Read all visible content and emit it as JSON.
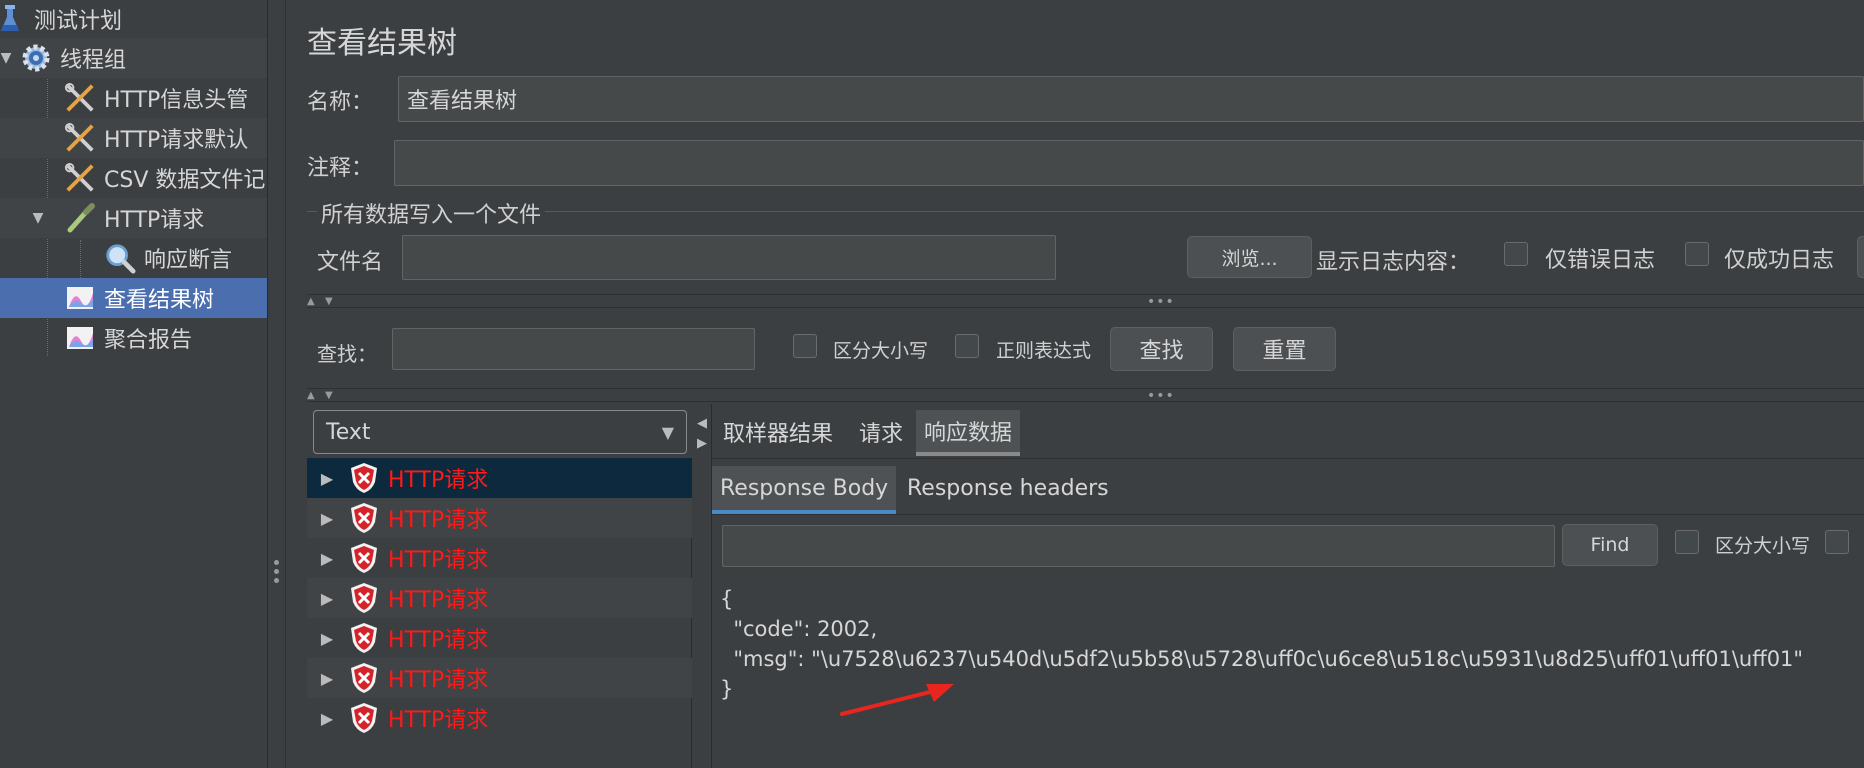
{
  "tree": {
    "items": [
      {
        "label": "测试计划",
        "icon": "flask-icon"
      },
      {
        "label": "线程组",
        "icon": "gear-icon"
      },
      {
        "label": "HTTP信息头管",
        "icon": "wrench-scissors-icon"
      },
      {
        "label": "HTTP请求默认",
        "icon": "wrench-scissors-icon"
      },
      {
        "label": "CSV 数据文件记",
        "icon": "wrench-scissors-icon"
      },
      {
        "label": "HTTP请求",
        "icon": "pipette-icon"
      },
      {
        "label": "响应断言",
        "icon": "magnifier-icon"
      },
      {
        "label": "查看结果树",
        "icon": "graph-icon"
      },
      {
        "label": "聚合报告",
        "icon": "graph-icon"
      }
    ]
  },
  "panel": {
    "title": "查看结果树",
    "name_label": "名称：",
    "name_value": "查看结果树",
    "comment_label": "注释：",
    "comment_value": "",
    "file_section_title": "所有数据写入一个文件",
    "filename_label": "文件名",
    "filename_value": "",
    "browse_button": "浏览...",
    "log_display_label": "显示日志内容：",
    "errors_only_label": "仅错误日志",
    "success_only_label": "仅成功日志"
  },
  "search": {
    "label": "查找：",
    "value": "",
    "case_sensitive_label": "区分大小写",
    "regex_label": "正则表达式",
    "find_button": "查找",
    "reset_button": "重置"
  },
  "renderer": {
    "selected": "Text"
  },
  "results": [
    {
      "label": "HTTP请求",
      "status": "error"
    },
    {
      "label": "HTTP请求",
      "status": "error"
    },
    {
      "label": "HTTP请求",
      "status": "error"
    },
    {
      "label": "HTTP请求",
      "status": "error"
    },
    {
      "label": "HTTP请求",
      "status": "error"
    },
    {
      "label": "HTTP请求",
      "status": "error"
    },
    {
      "label": "HTTP请求",
      "status": "error"
    }
  ],
  "detail_tabs": {
    "sampler_result": "取样器结果",
    "request": "请求",
    "response_data": "响应数据"
  },
  "response_tabs": {
    "body": "Response Body",
    "headers": "Response headers"
  },
  "response_search": {
    "value": "",
    "find_button": "Find",
    "case_sensitive_label": "区分大小写"
  },
  "response_body": "{\n  \"code\": 2002,\n  \"msg\": \"\\u7528\\u6237\\u540d\\u5df2\\u5b58\\u5728\\uff0c\\u6ce8\\u518c\\u5931\\u8d25\\uff01\\uff01\\uff01\"\n}",
  "colors": {
    "selected_tree": "#4b6eaf",
    "error_text": "#ff1a1a",
    "arrow_annotation": "#e8261f"
  }
}
